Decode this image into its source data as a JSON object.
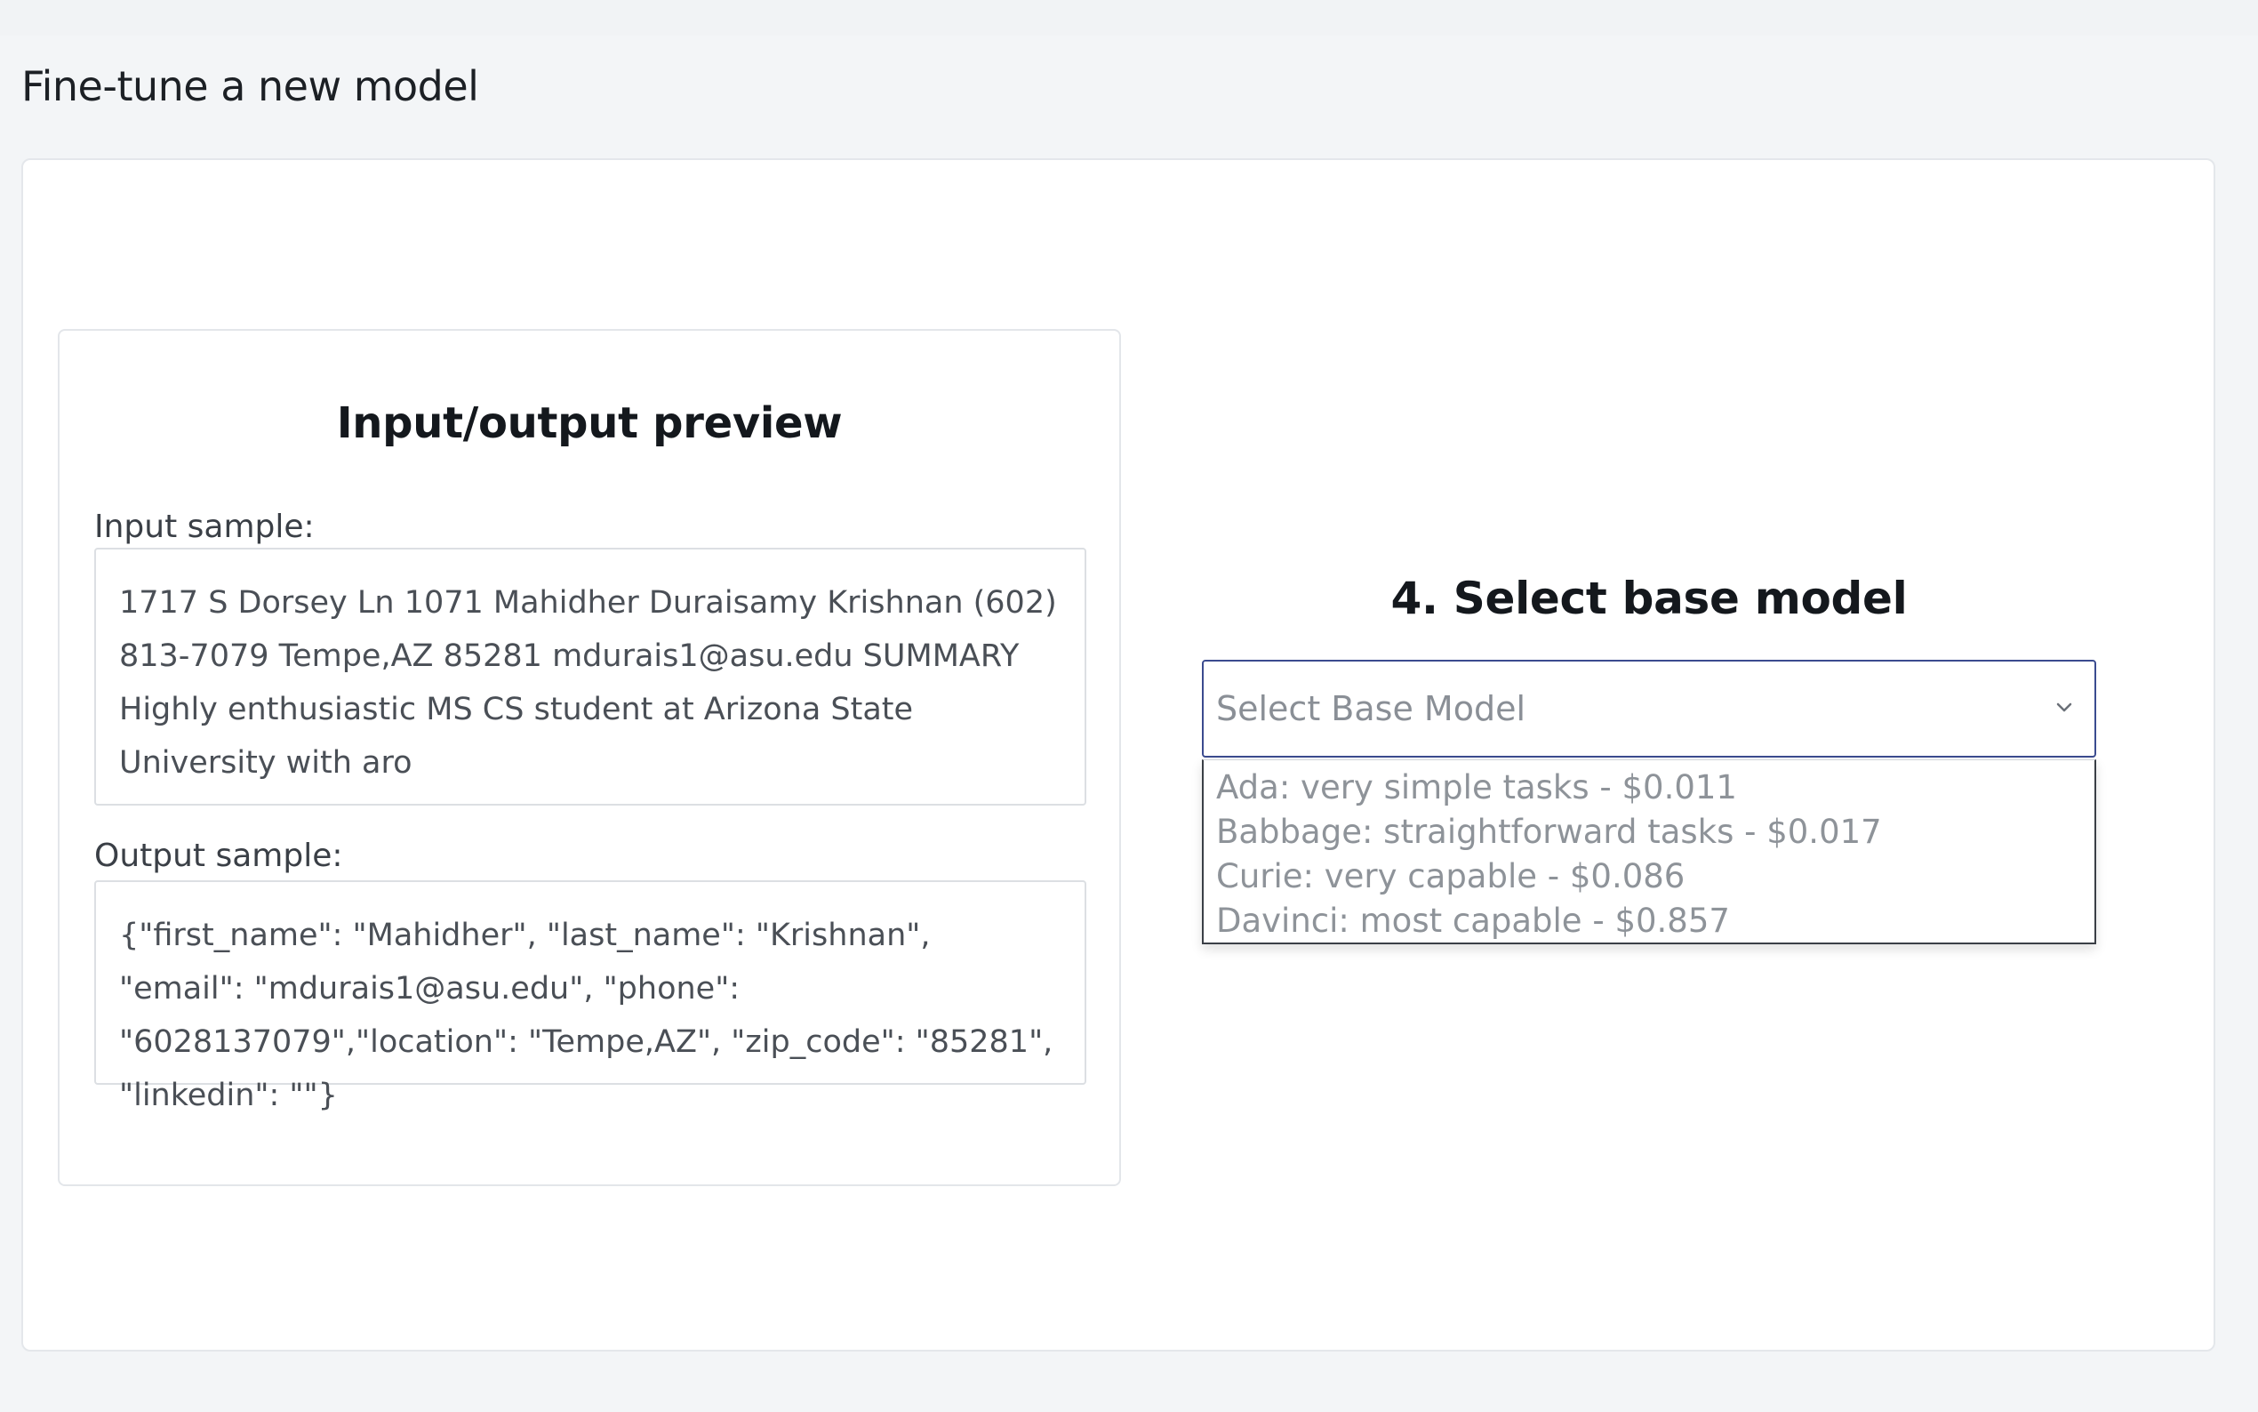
{
  "page": {
    "title": "Fine-tune a new model"
  },
  "preview": {
    "title": "Input/output preview",
    "input_label": "Input sample:",
    "input_text": "1717 S Dorsey Ln 1071 Mahidher Duraisamy Krishnan (602) 813-7079 Tempe,AZ 85281 mdurais1@asu.edu SUMMARY Highly enthusiastic MS CS student at Arizona State University with aro",
    "output_label": "Output sample:",
    "output_text": "{\"first_name\": \"Mahidher\", \"last_name\": \"Krishnan\", \"email\": \"mdurais1@asu.edu\", \"phone\": \"6028137079\",\"location\": \"Tempe,AZ\", \"zip_code\": \"85281\", \"linkedin\": \"\"}"
  },
  "base_model": {
    "title": "4. Select base model",
    "placeholder": "Select Base Model",
    "chevron_icon": "chevron-down-icon",
    "options": [
      "Ada: very simple tasks - $0.011",
      "Babbage: straightforward tasks - $0.017",
      "Curie: very capable - $0.086",
      "Davinci: most capable - $0.857"
    ]
  },
  "colors": {
    "background": "#f3f5f7",
    "card": "#ffffff",
    "select_border": "#3b4b8f",
    "option_text": "#8e9399"
  }
}
